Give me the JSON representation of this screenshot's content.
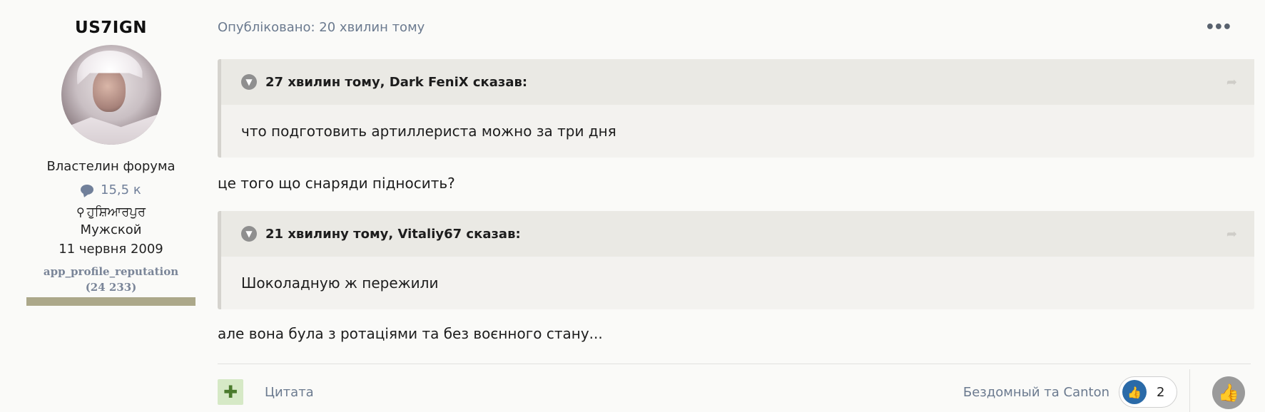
{
  "author": {
    "name": "US7IGN",
    "title": "Властелин форума",
    "posts_count": "15,5 к",
    "location": "ਹੁਸ਼ਿਆਰਪੁਰ",
    "gender": "Мужской",
    "joined": "11 червня 2009",
    "reputation_label": "app_profile_reputation",
    "reputation_value": "(24 233)"
  },
  "post": {
    "meta": "Опубліковано: 20 хвилин тому",
    "menu_icon": "•••",
    "quotes": [
      {
        "header": "27 хвилин тому, Dark FeniX сказав:",
        "body": "что подготовить артиллериста можно за три дня"
      },
      {
        "header": "21 хвилину тому, Vitaliy67 сказав:",
        "body": "Шоколадную ж пережили"
      }
    ],
    "texts": [
      "це того що снаряди підносить?",
      "але вона була з ротаціями та без воєнного стану..."
    ],
    "actions": {
      "quote_label": "Цитата",
      "reactors": "Бездомный та Canton",
      "reaction_count": "2"
    }
  },
  "colors": {
    "accent_link": "#6b7a8f",
    "reputation_bar": "#aca88a",
    "like_blue": "#2a6aa8",
    "plus_green_bg": "#d6e9c6"
  },
  "icons": [
    "comment-icon",
    "map-pin-icon",
    "chevron-down-icon",
    "share-icon",
    "ellipsis-icon",
    "plus-icon",
    "thumbs-up-icon"
  ]
}
